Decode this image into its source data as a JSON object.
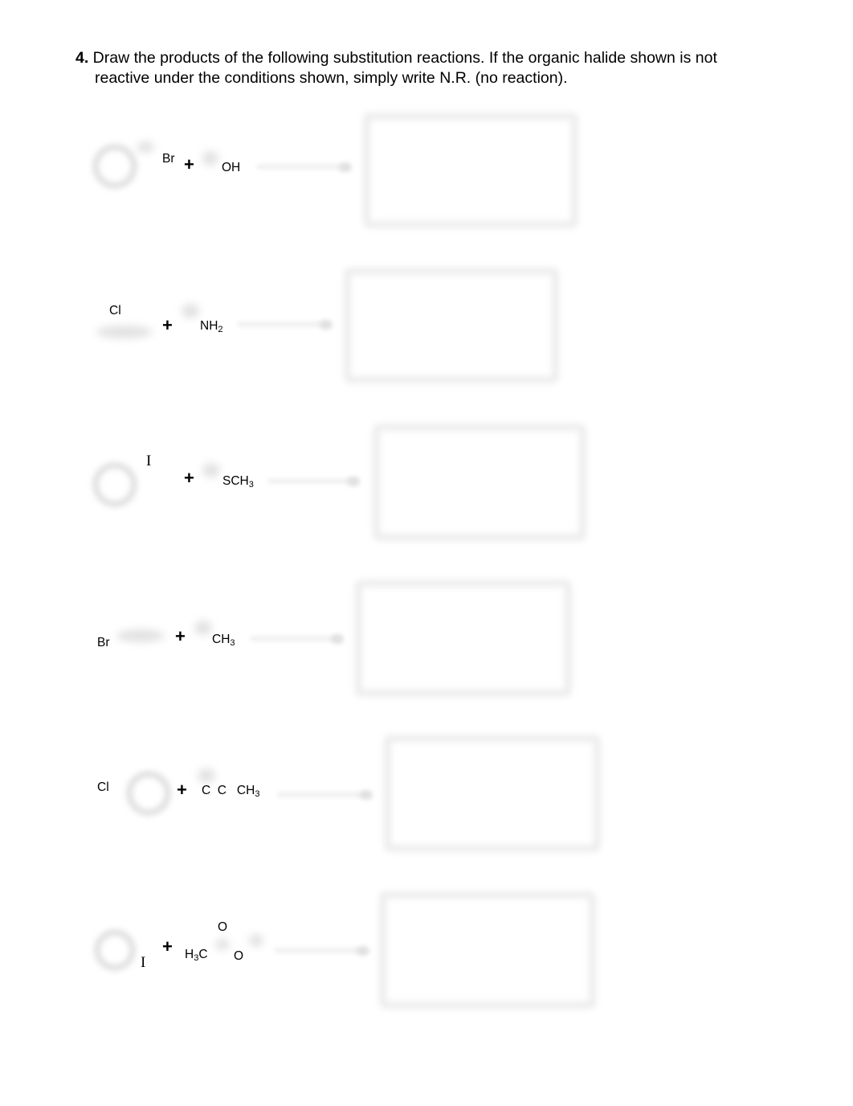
{
  "question": {
    "number": "4.",
    "line1": " Draw the products of the following substitution reactions.  If the organic halide shown is not",
    "line2": "reactive under the conditions shown, simply write N.R. (no reaction)."
  },
  "plus_sign": "+",
  "reactions": [
    {
      "halide_label": "Br",
      "nucleophile": "OH",
      "nucleophile_sub": ""
    },
    {
      "halide_label": "Cl",
      "nucleophile": "NH",
      "nucleophile_sub": "2"
    },
    {
      "halide_label": "I",
      "nucleophile": "SCH",
      "nucleophile_sub": "3"
    },
    {
      "halide_label": "Br",
      "nucleophile": "CH",
      "nucleophile_sub": "3"
    },
    {
      "halide_label": "Cl",
      "nucleophile": "C  C   CH",
      "nucleophile_sub": "3"
    },
    {
      "halide_label": "I",
      "nucleophile_prefix": "H",
      "nucleophile_prefix_sub": "3",
      "nucleophile": "C",
      "carbonyl_o": "O",
      "ester_o": "O"
    }
  ]
}
